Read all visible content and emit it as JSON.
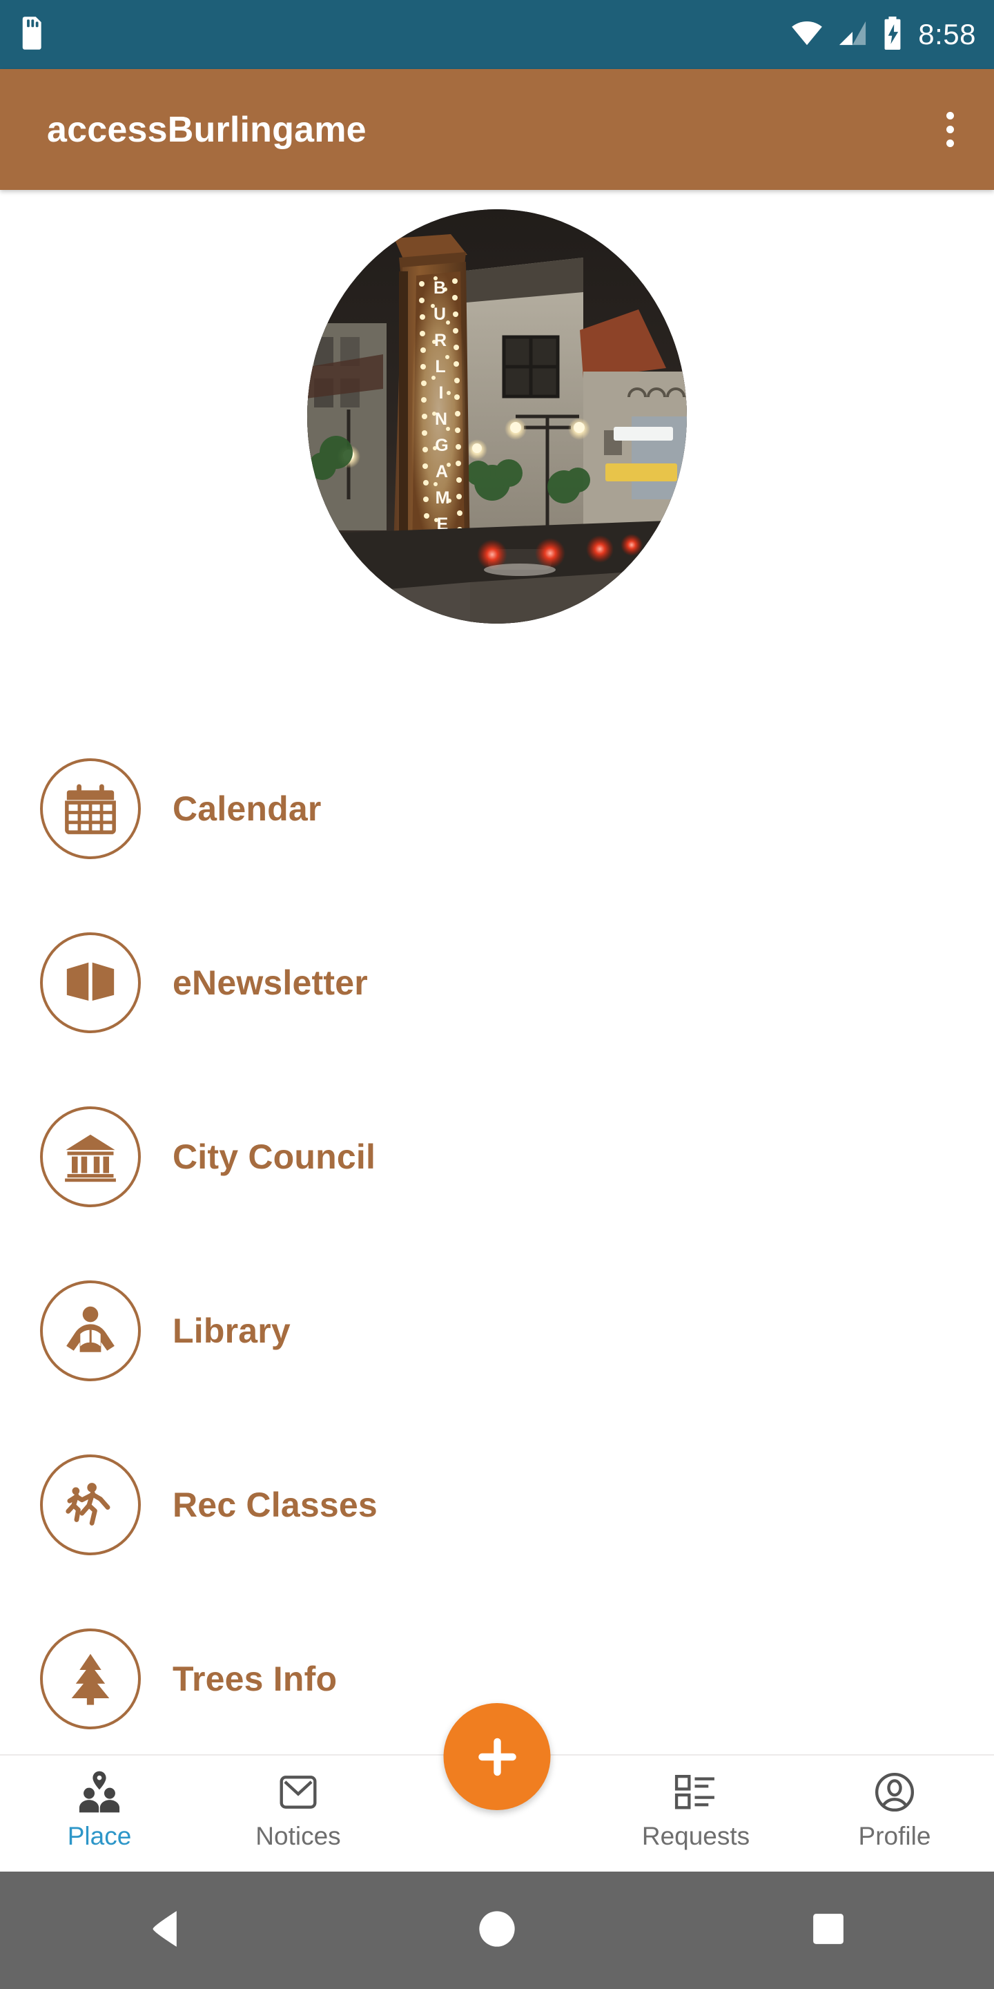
{
  "status_bar": {
    "background_color": "#1E5F78",
    "time": "8:58",
    "icons": [
      "sd-card-icon",
      "wifi-icon",
      "cellular-signal-icon",
      "battery-charging-icon"
    ]
  },
  "app_bar": {
    "title": "accessBurlingame",
    "background_color": "#A66C3F",
    "text_color": "#FFFFFF",
    "overflow_icon": "more-vert-icon"
  },
  "hero": {
    "alt": "Illuminated BURLINGAME vertical marquee sign on a city street at night",
    "sign_text": "BURLINGAME",
    "shape": "circle"
  },
  "accent_color": "#A66C3F",
  "list": {
    "items": [
      {
        "label": "Calendar",
        "icon": "calendar-icon"
      },
      {
        "label": "eNewsletter",
        "icon": "open-book-icon"
      },
      {
        "label": "City Council",
        "icon": "bank-building-icon"
      },
      {
        "label": "Library",
        "icon": "person-reading-icon"
      },
      {
        "label": "Rec Classes",
        "icon": "running-people-icon"
      },
      {
        "label": "Trees Info",
        "icon": "pine-tree-icon"
      }
    ]
  },
  "bottom_nav": {
    "active_color": "#2D96C8",
    "inactive_color": "#6E6E6E",
    "fab": {
      "icon": "plus-icon",
      "color": "#F07E20"
    },
    "items": [
      {
        "label": "Place",
        "icon": "people-place-pin-icon",
        "active": true
      },
      {
        "label": "Notices",
        "icon": "envelope-icon",
        "active": false
      },
      {
        "label": "Requests",
        "icon": "list-checkbox-icon",
        "active": false
      },
      {
        "label": "Profile",
        "icon": "person-avatar-icon",
        "active": false
      }
    ]
  },
  "android_nav": {
    "background_color": "#666666",
    "buttons": [
      {
        "name": "back-button",
        "icon": "triangle-back-icon"
      },
      {
        "name": "home-button",
        "icon": "circle-home-icon"
      },
      {
        "name": "recents-button",
        "icon": "square-recents-icon"
      }
    ]
  }
}
